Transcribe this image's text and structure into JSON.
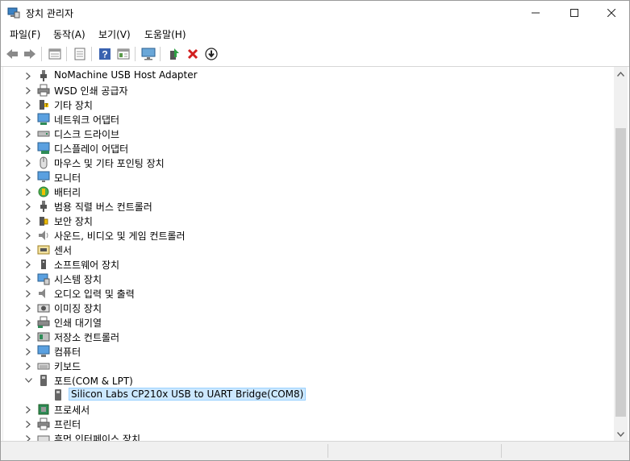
{
  "window": {
    "title": "장치 관리자",
    "icon": "device-manager-icon",
    "controls": [
      "minimize-icon",
      "maximize-icon",
      "close-icon"
    ]
  },
  "menu": [
    {
      "label": "파일(F)"
    },
    {
      "label": "동작(A)"
    },
    {
      "label": "보기(V)"
    },
    {
      "label": "도움말(H)"
    }
  ],
  "toolbar": {
    "buttons": [
      "back-icon",
      "forward-icon",
      "properties-view-icon",
      "properties-icon",
      "help-icon",
      "details-icon",
      "scan-hardware-icon",
      "update-driver-icon",
      "uninstall-icon",
      "download-icon"
    ]
  },
  "tree": {
    "items": [
      {
        "label": "NoMachine USB Host Adapter",
        "icon": "usb-plug-icon",
        "expanded": false
      },
      {
        "label": "WSD 인쇄 공급자",
        "icon": "printer-icon",
        "expanded": false
      },
      {
        "label": "기타 장치",
        "icon": "unknown-device-icon",
        "expanded": false
      },
      {
        "label": "네트워크 어댑터",
        "icon": "network-adapter-icon",
        "expanded": false
      },
      {
        "label": "디스크 드라이브",
        "icon": "disk-drive-icon",
        "expanded": false
      },
      {
        "label": "디스플레이 어댑터",
        "icon": "display-adapter-icon",
        "expanded": false
      },
      {
        "label": "마우스 및 기타 포인팅 장치",
        "icon": "mouse-icon",
        "expanded": false
      },
      {
        "label": "모니터",
        "icon": "monitor-icon",
        "expanded": false
      },
      {
        "label": "배터리",
        "icon": "battery-icon",
        "expanded": false
      },
      {
        "label": "범용 직렬 버스 컨트롤러",
        "icon": "usb-controller-icon",
        "expanded": false
      },
      {
        "label": "보안 장치",
        "icon": "security-device-icon",
        "expanded": false
      },
      {
        "label": "사운드, 비디오 및 게임 컨트롤러",
        "icon": "speaker-icon",
        "expanded": false
      },
      {
        "label": "센서",
        "icon": "sensor-icon",
        "expanded": false
      },
      {
        "label": "소프트웨어 장치",
        "icon": "software-device-icon",
        "expanded": false
      },
      {
        "label": "시스템 장치",
        "icon": "system-device-icon",
        "expanded": false
      },
      {
        "label": "오디오 입력 및 출력",
        "icon": "audio-icon",
        "expanded": false
      },
      {
        "label": "이미징 장치",
        "icon": "camera-icon",
        "expanded": false
      },
      {
        "label": "인쇄 대기열",
        "icon": "print-queue-icon",
        "expanded": false
      },
      {
        "label": "저장소 컨트롤러",
        "icon": "storage-controller-icon",
        "expanded": false
      },
      {
        "label": "컴퓨터",
        "icon": "computer-icon",
        "expanded": false
      },
      {
        "label": "키보드",
        "icon": "keyboard-icon",
        "expanded": false
      },
      {
        "label": "포트(COM & LPT)",
        "icon": "port-icon",
        "expanded": true
      },
      {
        "label": "Silicon Labs CP210x USB to UART Bridge(COM8)",
        "icon": "port-device-icon",
        "child": true,
        "selected": true
      },
      {
        "label": "프로세서",
        "icon": "processor-icon",
        "expanded": false
      },
      {
        "label": "프린터",
        "icon": "printer-icon",
        "expanded": false
      },
      {
        "label": "휴먼 인터페이스 장치",
        "icon": "hid-icon",
        "expanded": false
      }
    ]
  },
  "colors": {
    "selection_bg": "#cce8ff",
    "selection_border": "#99d1ff",
    "scroll_thumb": "#cdcdcd"
  }
}
